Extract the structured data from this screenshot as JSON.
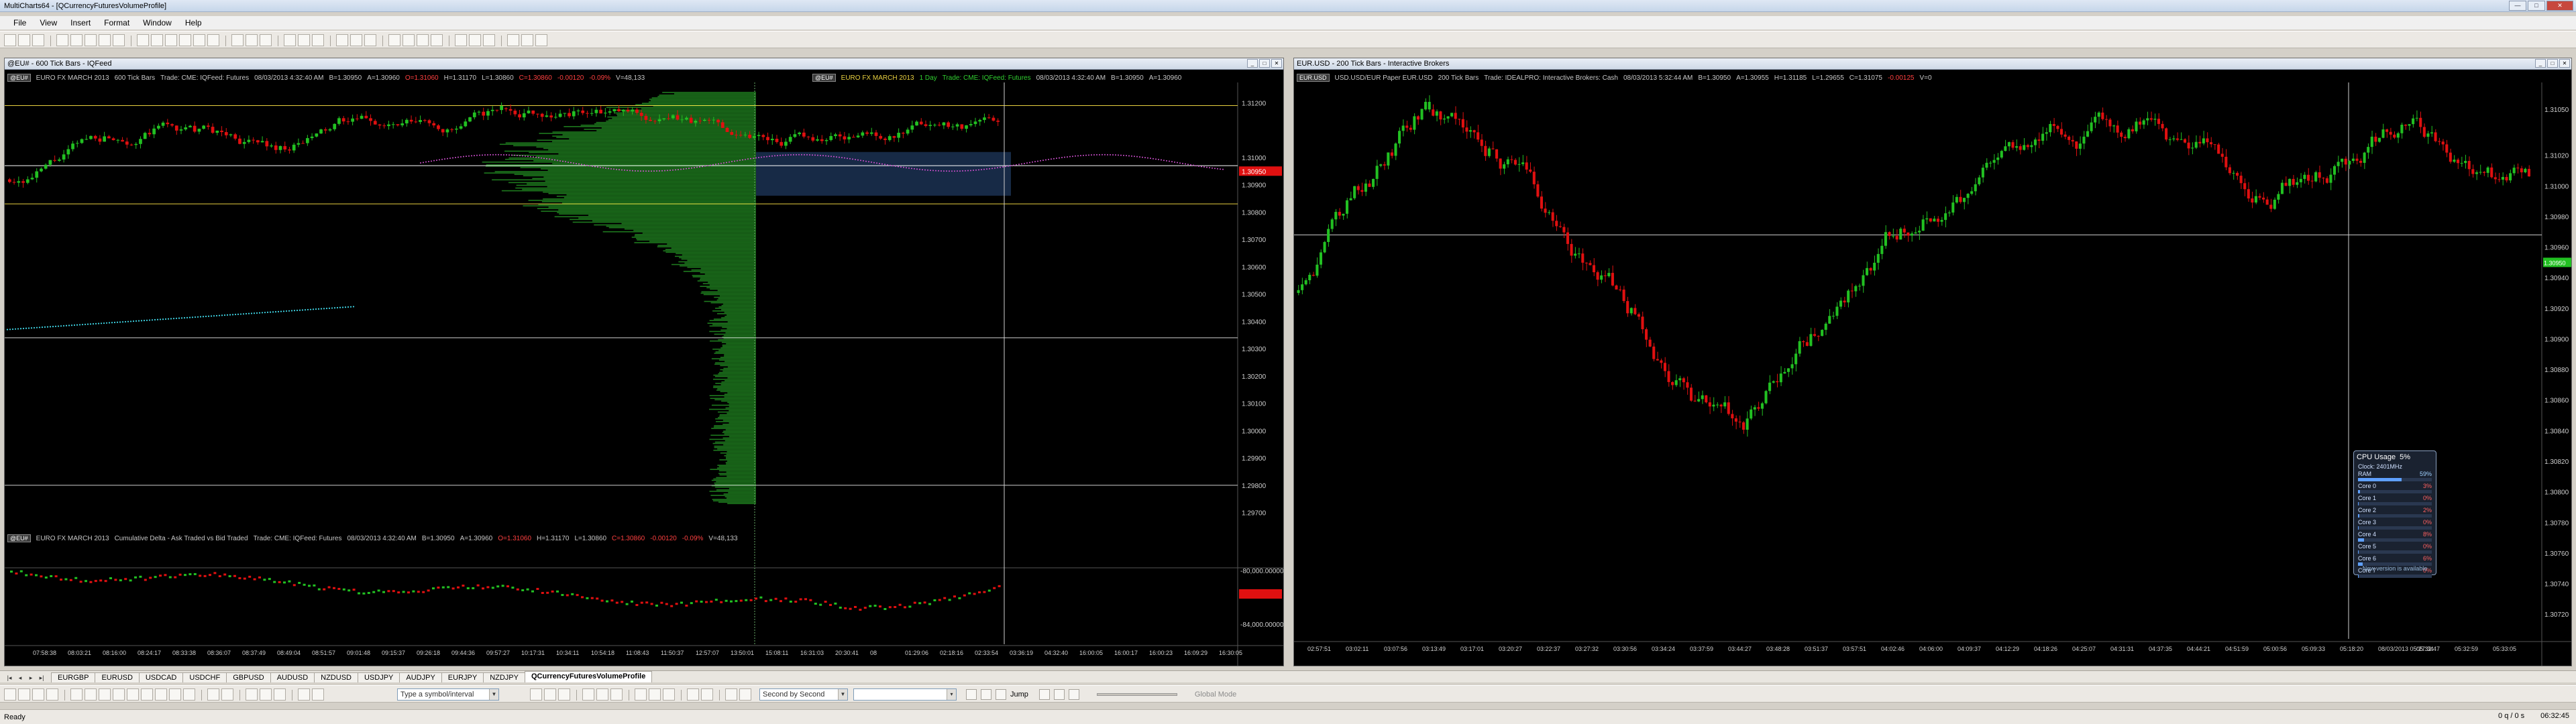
{
  "app": {
    "title": "MultiCharts64 - [QCurrencyFuturesVolumeProfile]",
    "menu": [
      "File",
      "View",
      "Insert",
      "Format",
      "Window",
      "Help"
    ]
  },
  "left_chart": {
    "window_title": "@EU# - 600 Tick Bars - IQFeed",
    "info_line_1": {
      "tag": "@EU#",
      "symbol_desc": "EURO FX MARCH 2013",
      "resolution": "600 Tick Bars",
      "feed": "Trade: CME: IQFeed: Futures",
      "datetime": "08/03/2013 4:32:40 AM",
      "b": "B=1.30950",
      "a": "A=1.30960",
      "o": "O=1.31060",
      "h": "H=1.31170",
      "l": "L=1.30860",
      "c": "C=1.30860",
      "change": "-0.00120",
      "pct": "-0.09%",
      "vol": "V=48,133"
    },
    "info_line_1b": {
      "tag": "@EU#",
      "symbol_desc": "EURO FX MARCH 2013",
      "resolution": "1 Day",
      "feed": "Trade: CME: IQFeed: Futures",
      "datetime": "08/03/2013 4:32:40 AM",
      "b": "B=1.30950",
      "a": "A=1.30960"
    },
    "info_line_2": {
      "tag": "@EU#",
      "symbol_desc": "EURO FX MARCH 2013",
      "study": "Cumulative Delta - Ask Traded vs Bid Traded",
      "feed": "Trade: CME: IQFeed: Futures",
      "datetime": "08/03/2013 4:32:40 AM",
      "b": "B=1.30950",
      "a": "A=1.30960",
      "o": "O=1.31060",
      "h": "H=1.31170",
      "l": "L=1.30860",
      "c": "C=1.30860",
      "change": "-0.00120",
      "pct": "-0.09%",
      "vol": "V=48,133"
    },
    "price_axis": [
      "1.31200",
      "1.31000",
      "1.30900",
      "1.30800",
      "1.30700",
      "1.30600",
      "1.30500",
      "1.30400",
      "1.30300",
      "1.30200",
      "1.30100",
      "1.30000",
      "1.29900",
      "1.29800",
      "1.29700"
    ],
    "last_price_label": "1.30950",
    "delta_axis": [
      "-80,000.00000",
      "-84,000.00000"
    ],
    "time_axis": [
      "07:58:38",
      "08:03:21",
      "08:16:00",
      "08:24:17",
      "08:33:38",
      "08:36:07",
      "08:37:49",
      "08:49:04",
      "08:51:57",
      "09:01:48",
      "09:15:37",
      "09:26:18",
      "09:44:36",
      "09:57:27",
      "10:17:31",
      "10:34:11",
      "10:54:18",
      "11:08:43",
      "11:50:37",
      "12:57:07",
      "13:50:01",
      "15:08:11",
      "16:31:03",
      "20:30:41",
      "08",
      "01:29:06",
      "02:18:16",
      "02:33:54",
      "03:36:19",
      "04:32:40",
      "16:00:05",
      "16:00:17",
      "16:00:23",
      "16:09:29",
      "16:30:05"
    ]
  },
  "right_chart": {
    "window_title": "EUR.USD - 200 Tick Bars - Interactive Brokers",
    "info_line": {
      "tag": "EUR.USD",
      "symbol_desc": "USD.USD/EUR Paper EUR.USD",
      "resolution": "200 Tick Bars",
      "feed": "Trade: IDEALPRO: Interactive Brokers: Cash",
      "datetime": "08/03/2013 5:32:44 AM",
      "b": "B=1.30950",
      "a": "A=1.30955",
      "h": "H=1.31185",
      "l": "L=1.29655",
      "c": "C=1.31075",
      "change": "-0.00125",
      "vol": "V=0"
    },
    "price_axis": [
      "1.31050",
      "1.31020",
      "1.31000",
      "1.30980",
      "1.30960",
      "1.30940",
      "1.30920",
      "1.30900",
      "1.30880",
      "1.30860",
      "1.30840",
      "1.30820",
      "1.30800",
      "1.30780",
      "1.30760",
      "1.30740",
      "1.30720"
    ],
    "last_price_label": "1.30950",
    "time_axis": [
      "02:57:51",
      "03:02:11",
      "03:07:56",
      "03:13:49",
      "03:17:01",
      "03:20:27",
      "03:22:37",
      "03:27:32",
      "03:30:56",
      "03:34:24",
      "03:37:59",
      "03:44:27",
      "03:48:28",
      "03:51:37",
      "03:57:51",
      "04:02:46",
      "04:06:00",
      "04:09:37",
      "04:12:29",
      "04:18:26",
      "04:25:07",
      "04:31:31",
      "04:37:35",
      "04:44:21",
      "04:51:59",
      "05:00:56",
      "05:09:33",
      "05:18:20",
      "08/03/2013 05:27:34",
      "05:32:47",
      "05:32:59",
      "05:33:05"
    ]
  },
  "cpu_widget": {
    "title": "CPU Usage",
    "percent": "5%",
    "clock": "Clock: 2401MHz",
    "rows": [
      {
        "name": "RAM",
        "value": "59%"
      },
      {
        "name": "Core 0",
        "value": "3%"
      },
      {
        "name": "Core 1",
        "value": "0%"
      },
      {
        "name": "Core 2",
        "value": "2%"
      },
      {
        "name": "Core 3",
        "value": "0%"
      },
      {
        "name": "Core 4",
        "value": "8%"
      },
      {
        "name": "Core 5",
        "value": "0%"
      },
      {
        "name": "Core 6",
        "value": "6%"
      },
      {
        "name": "Core 7",
        "value": "0%"
      }
    ],
    "footer": "New version is available"
  },
  "symbol_tabs": [
    "EURGBP",
    "EURUSD",
    "USDCAD",
    "USDCHF",
    "GBPUSD",
    "AUDUSD",
    "NZDUSD",
    "USDJPY",
    "AUDJPY",
    "EURJPY",
    "NZDJPY",
    "QCurrencyFuturesVolumeProfile"
  ],
  "active_tab": "QCurrencyFuturesVolumeProfile",
  "drawing_bar": {
    "symbol_input_placeholder": "Type a symbol/interval",
    "replay_mode": "Second by Second",
    "jump_label": "Jump",
    "global_mode_label": "Global Mode"
  },
  "status": {
    "left": "Ready",
    "latency": "0 q / 0 s",
    "time": "06:32:45"
  },
  "colors": {
    "up": "#22c022",
    "down": "#e01010",
    "volume_profile": "#1e7a1e",
    "value_area": "#2a4d80",
    "background": "#000000"
  }
}
